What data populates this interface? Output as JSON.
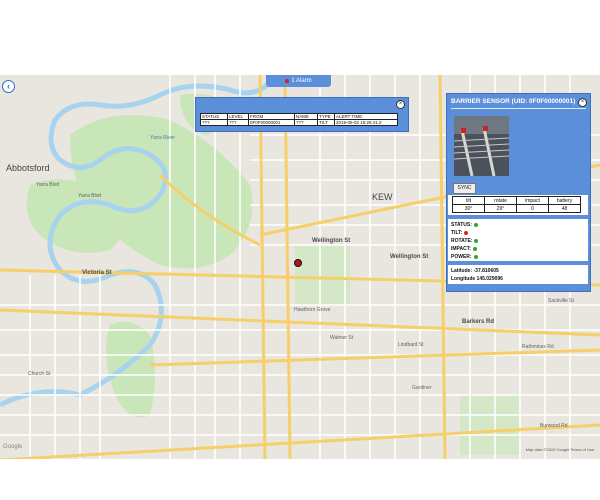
{
  "alarm_tab": {
    "label": "1 Alarm"
  },
  "alarm_popup": {
    "columns": [
      "STATUS",
      "LEVEL",
      "FROM",
      "NAME",
      "TYPE",
      "ALERT TIME"
    ],
    "rows": [
      [
        "???",
        "???",
        "0F0F00000001",
        "???",
        "TILT",
        "2019-05-02 15:26:41.0"
      ]
    ]
  },
  "sensor": {
    "title": "BARRIER SENSOR (UID: 0F0F00000001)",
    "sync_label": "SYNC",
    "readings_headers": [
      "tilt",
      "rotate",
      "impact",
      "battery"
    ],
    "readings_values": [
      "30°",
      "29°",
      "0",
      "48"
    ],
    "status_rows": [
      {
        "label": "STATUS:",
        "color": "#2fa52f"
      },
      {
        "label": "TILT:",
        "color": "#e02020"
      },
      {
        "label": "ROTATE:",
        "color": "#2fa52f"
      },
      {
        "label": "IMPACT:",
        "color": "#2fa52f"
      },
      {
        "label": "POWER:",
        "color": "#2fa52f"
      }
    ],
    "latitude": "Latitude: -37.810605",
    "longitude": "Longitude 145.029096"
  },
  "map": {
    "labels": {
      "abbotsford": "Abbotsford",
      "victoria_st": "Victoria St",
      "barkers_rd": "Barkers Rd",
      "wellington_st": "Wellington St",
      "wellington_st_2": "Wellington St",
      "kew": "KEW",
      "yarra_blvd": "Yarra Blvd",
      "yarra_blvd_2": "Yarra Blvd",
      "yarra_river": "Yarra River",
      "walmer_st": "Walmer St",
      "lindbard_st": "Lindbard St",
      "sackville_st": "Sackville St",
      "rathmines_rd": "Rathmines Rd",
      "burwood_rd": "Burwood Rd",
      "church_st": "Church St",
      "hawthorn_gr": "Hawthorn Grove",
      "gardiner": "Gardiner"
    },
    "google": "Google",
    "attribution": "Map data ©2019 Google   Terms of Use"
  },
  "colors": {
    "panel": "#5b8fd9",
    "marker": "#b8121e",
    "park": "#c8e6b8",
    "water": "#a8d3ef",
    "road_major": "#f6cf69",
    "road_minor": "#ffffff"
  }
}
